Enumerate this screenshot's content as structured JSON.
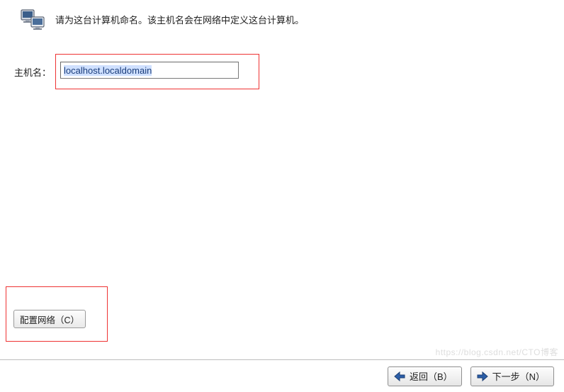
{
  "header": {
    "description": "请为这台计算机命名。该主机名会在网络中定义这台计算机。",
    "icon": "computer-network-icon"
  },
  "form": {
    "hostname_label": "主机名：",
    "hostname_value": "localhost.localdomain"
  },
  "buttons": {
    "configure_network": "配置网络（C）",
    "back": "返回（B）",
    "next": "下一步（N）"
  },
  "watermark": "https://blog.csdn.net/CTO博客"
}
